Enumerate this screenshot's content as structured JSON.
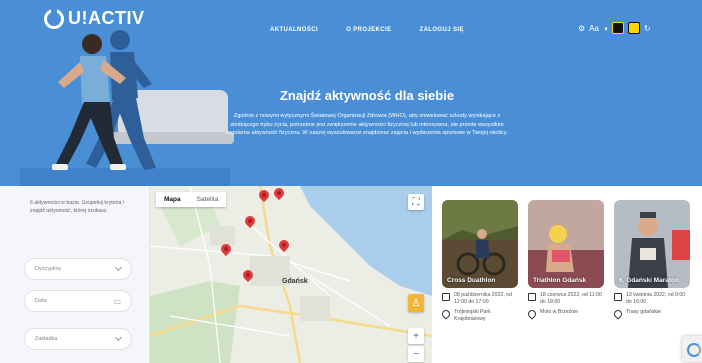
{
  "header": {
    "logo_text": "U!ACTIV",
    "nav": [
      "AKTUALNOŚCI",
      "O PROJEKCIE",
      "ZALOGUJ SIĘ"
    ],
    "tools_label": "Aa"
  },
  "hero": {
    "title": "Znajdź aktywność dla siebie",
    "description": "Zgodnie z nowymi wytycznymi Światowej Organizacji Zdrowia (WHO), aby zniwelować szkody wynikające z siedzącego trybu życia, potrzebne jest zwiększenie aktywności fizycznej lub intensywna, ale przede wszystkim regularna aktywność fizyczna. W naszej wyszukiwarce znajdziesz zajęcia i wydarzenia sportowe w Twojej okolicy."
  },
  "filters": {
    "intro": "6 aktywności w bazie. Uzupełnij kryteria i znajdź aktywność, której szukasz.",
    "discipline_placeholder": "Dyscypliny",
    "date_placeholder": "Data",
    "level_placeholder": "Zakładka"
  },
  "map": {
    "tab_map": "Mapa",
    "tab_satellite": "Satelita",
    "city_label": "Gdańsk",
    "zoom_in": "+",
    "zoom_out": "−"
  },
  "events": [
    {
      "name": "Cross Duathlon",
      "date": "08 października 2022, od 12:00 do 17:00",
      "place": "Trójmiejski Park Krajobrazowy",
      "colors": [
        "#5c4a34",
        "#6e7a44",
        "#2b2a20"
      ]
    },
    {
      "name": "Triathlon Gdańsk",
      "date": "18 czerwca 2022, od 11:00 do 18:00",
      "place": "Molo w Brzeźnie",
      "colors": [
        "#c2a7a0",
        "#f4d24c",
        "#8a4c52"
      ]
    },
    {
      "name": "6. Gdański Maraton",
      "date": "13 kwietnia 2022, od 9:00 do 16:00",
      "place": "Trasy gdańskie",
      "colors": [
        "#b6bcc4",
        "#3a3f48",
        "#e9e4dd"
      ]
    }
  ],
  "colors": {
    "hero_bg": "#4a8fd6",
    "pin": "#e03a3a",
    "tool_yellow": "#ffd400"
  }
}
